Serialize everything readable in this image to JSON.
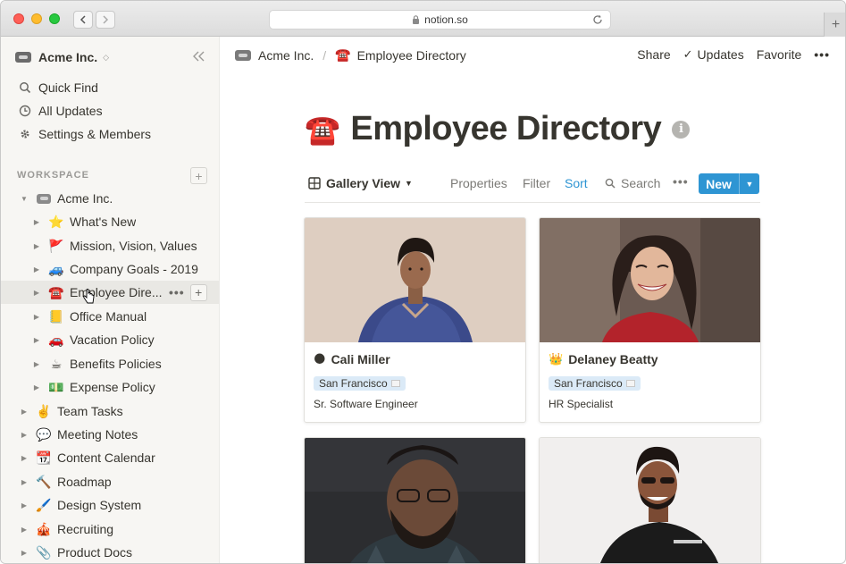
{
  "browser": {
    "url": "notion.so"
  },
  "sidebar": {
    "workspace_name": "Acme Inc.",
    "quick_links": [
      {
        "label": "Quick Find",
        "icon": "search-icon"
      },
      {
        "label": "All Updates",
        "icon": "clock-icon"
      },
      {
        "label": "Settings & Members",
        "icon": "gear-icon"
      }
    ],
    "section_label": "WORKSPACE",
    "tree": [
      {
        "emoji": "",
        "label": "Acme Inc.",
        "level": 0,
        "expanded": true
      },
      {
        "emoji": "⭐",
        "label": "What's New",
        "level": 1
      },
      {
        "emoji": "🚩",
        "label": "Mission, Vision, Values",
        "level": 1
      },
      {
        "emoji": "🚙",
        "label": "Company Goals - 2019",
        "level": 1
      },
      {
        "emoji": "☎️",
        "label": "Employee Dire...",
        "level": 1,
        "selected": true
      },
      {
        "emoji": "📒",
        "label": "Office Manual",
        "level": 1
      },
      {
        "emoji": "🚗",
        "label": "Vacation Policy",
        "level": 1
      },
      {
        "emoji": "☕",
        "label": "Benefits Policies",
        "level": 1
      },
      {
        "emoji": "💵",
        "label": "Expense Policy",
        "level": 1
      },
      {
        "emoji": "✌️",
        "label": "Team Tasks",
        "level": 0
      },
      {
        "emoji": "💬",
        "label": "Meeting Notes",
        "level": 0
      },
      {
        "emoji": "📆",
        "label": "Content Calendar",
        "level": 0
      },
      {
        "emoji": "🔨",
        "label": "Roadmap",
        "level": 0
      },
      {
        "emoji": "🖌️",
        "label": "Design System",
        "level": 0
      },
      {
        "emoji": "🎪",
        "label": "Recruiting",
        "level": 0
      },
      {
        "emoji": "📎",
        "label": "Product Docs",
        "level": 0
      }
    ]
  },
  "topbar": {
    "breadcrumb_root": "Acme Inc.",
    "breadcrumb_separator": "/",
    "breadcrumb_page_emoji": "☎️",
    "breadcrumb_page": "Employee Directory",
    "share_label": "Share",
    "updates_label": "Updates",
    "favorite_label": "Favorite"
  },
  "page": {
    "emoji": "☎️",
    "title": "Employee Directory"
  },
  "view_bar": {
    "view_name": "Gallery View",
    "properties_label": "Properties",
    "filter_label": "Filter",
    "sort_label": "Sort",
    "search_label": "Search",
    "new_label": "New"
  },
  "cards": [
    {
      "emoji": "🌑",
      "name": "Cali Miller",
      "location": "San Francisco",
      "role": "Sr. Software Engineer"
    },
    {
      "emoji": "👑",
      "name": "Delaney Beatty",
      "location": "San Francisco",
      "role": "HR Specialist"
    },
    {
      "emoji": "",
      "name": "",
      "location": "",
      "role": ""
    },
    {
      "emoji": "",
      "name": "",
      "location": "",
      "role": ""
    }
  ],
  "colors": {
    "accent": "#2e95d3",
    "sidebar_bg": "#f7f6f3",
    "tag_bg": "#dbeaf7",
    "text": "#37352f"
  }
}
